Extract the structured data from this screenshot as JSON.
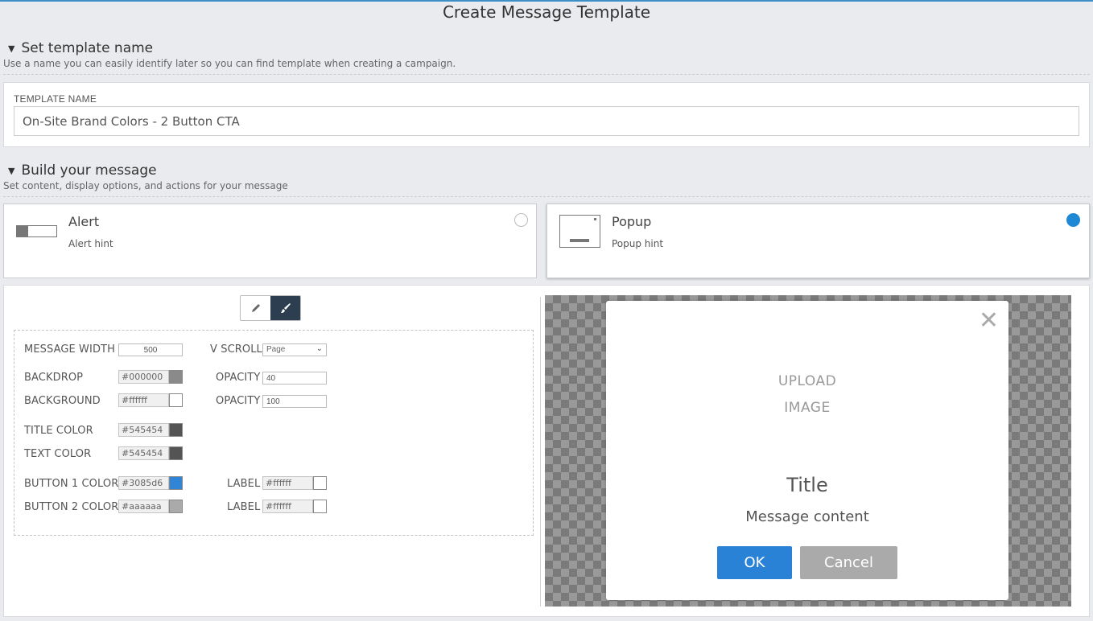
{
  "page": {
    "title": "Create Message Template"
  },
  "sections": {
    "name": {
      "title": "Set template name",
      "hint": "Use a name you can easily identify later so you can find template when creating a campaign."
    },
    "build": {
      "title": "Build your message",
      "hint": "Set content, display options, and actions for your message"
    }
  },
  "template_name": {
    "label": "TEMPLATE NAME",
    "value": "On-Site Brand Colors - 2 Button CTA"
  },
  "message_types": [
    {
      "title": "Alert",
      "hint": "Alert hint",
      "selected": false
    },
    {
      "title": "Popup",
      "hint": "Popup hint",
      "selected": true
    }
  ],
  "editor": {
    "mode_buttons": [
      {
        "icon": "pencil-icon",
        "active": false
      },
      {
        "icon": "brush-icon",
        "active": true
      }
    ]
  },
  "properties": {
    "message_width": {
      "label": "MESSAGE WIDTH",
      "value": "500"
    },
    "v_scroll": {
      "label": "V SCROLL",
      "value": "Page"
    },
    "backdrop": {
      "label": "BACKDROP",
      "value": "#000000",
      "swatch": "#8a8a8a"
    },
    "backdrop_opacity": {
      "label": "OPACITY",
      "value": "40"
    },
    "background": {
      "label": "BACKGROUND",
      "value": "#ffffff",
      "swatch": "#ffffff"
    },
    "background_opacity": {
      "label": "OPACITY",
      "value": "100"
    },
    "title_color": {
      "label": "TITLE COLOR",
      "value": "#545454",
      "swatch": "#545454"
    },
    "text_color": {
      "label": "TEXT COLOR",
      "value": "#545454",
      "swatch": "#545454"
    },
    "button1_color": {
      "label": "BUTTON 1 COLOR",
      "value": "#3085d6",
      "swatch": "#3085d6"
    },
    "button1_label": {
      "label": "LABEL",
      "value": "#ffffff",
      "swatch": "#ffffff"
    },
    "button2_color": {
      "label": "BUTTON 2 COLOR",
      "value": "#aaaaaa",
      "swatch": "#aaaaaa"
    },
    "button2_label": {
      "label": "LABEL",
      "value": "#ffffff",
      "swatch": "#ffffff"
    }
  },
  "preview": {
    "upload_line1": "UPLOAD",
    "upload_line2": "IMAGE",
    "title": "Title",
    "content": "Message content",
    "ok_label": "OK",
    "cancel_label": "Cancel",
    "ok_color": "#2a82d6",
    "cancel_color": "#aaaaaa",
    "close_glyph": "✕"
  }
}
